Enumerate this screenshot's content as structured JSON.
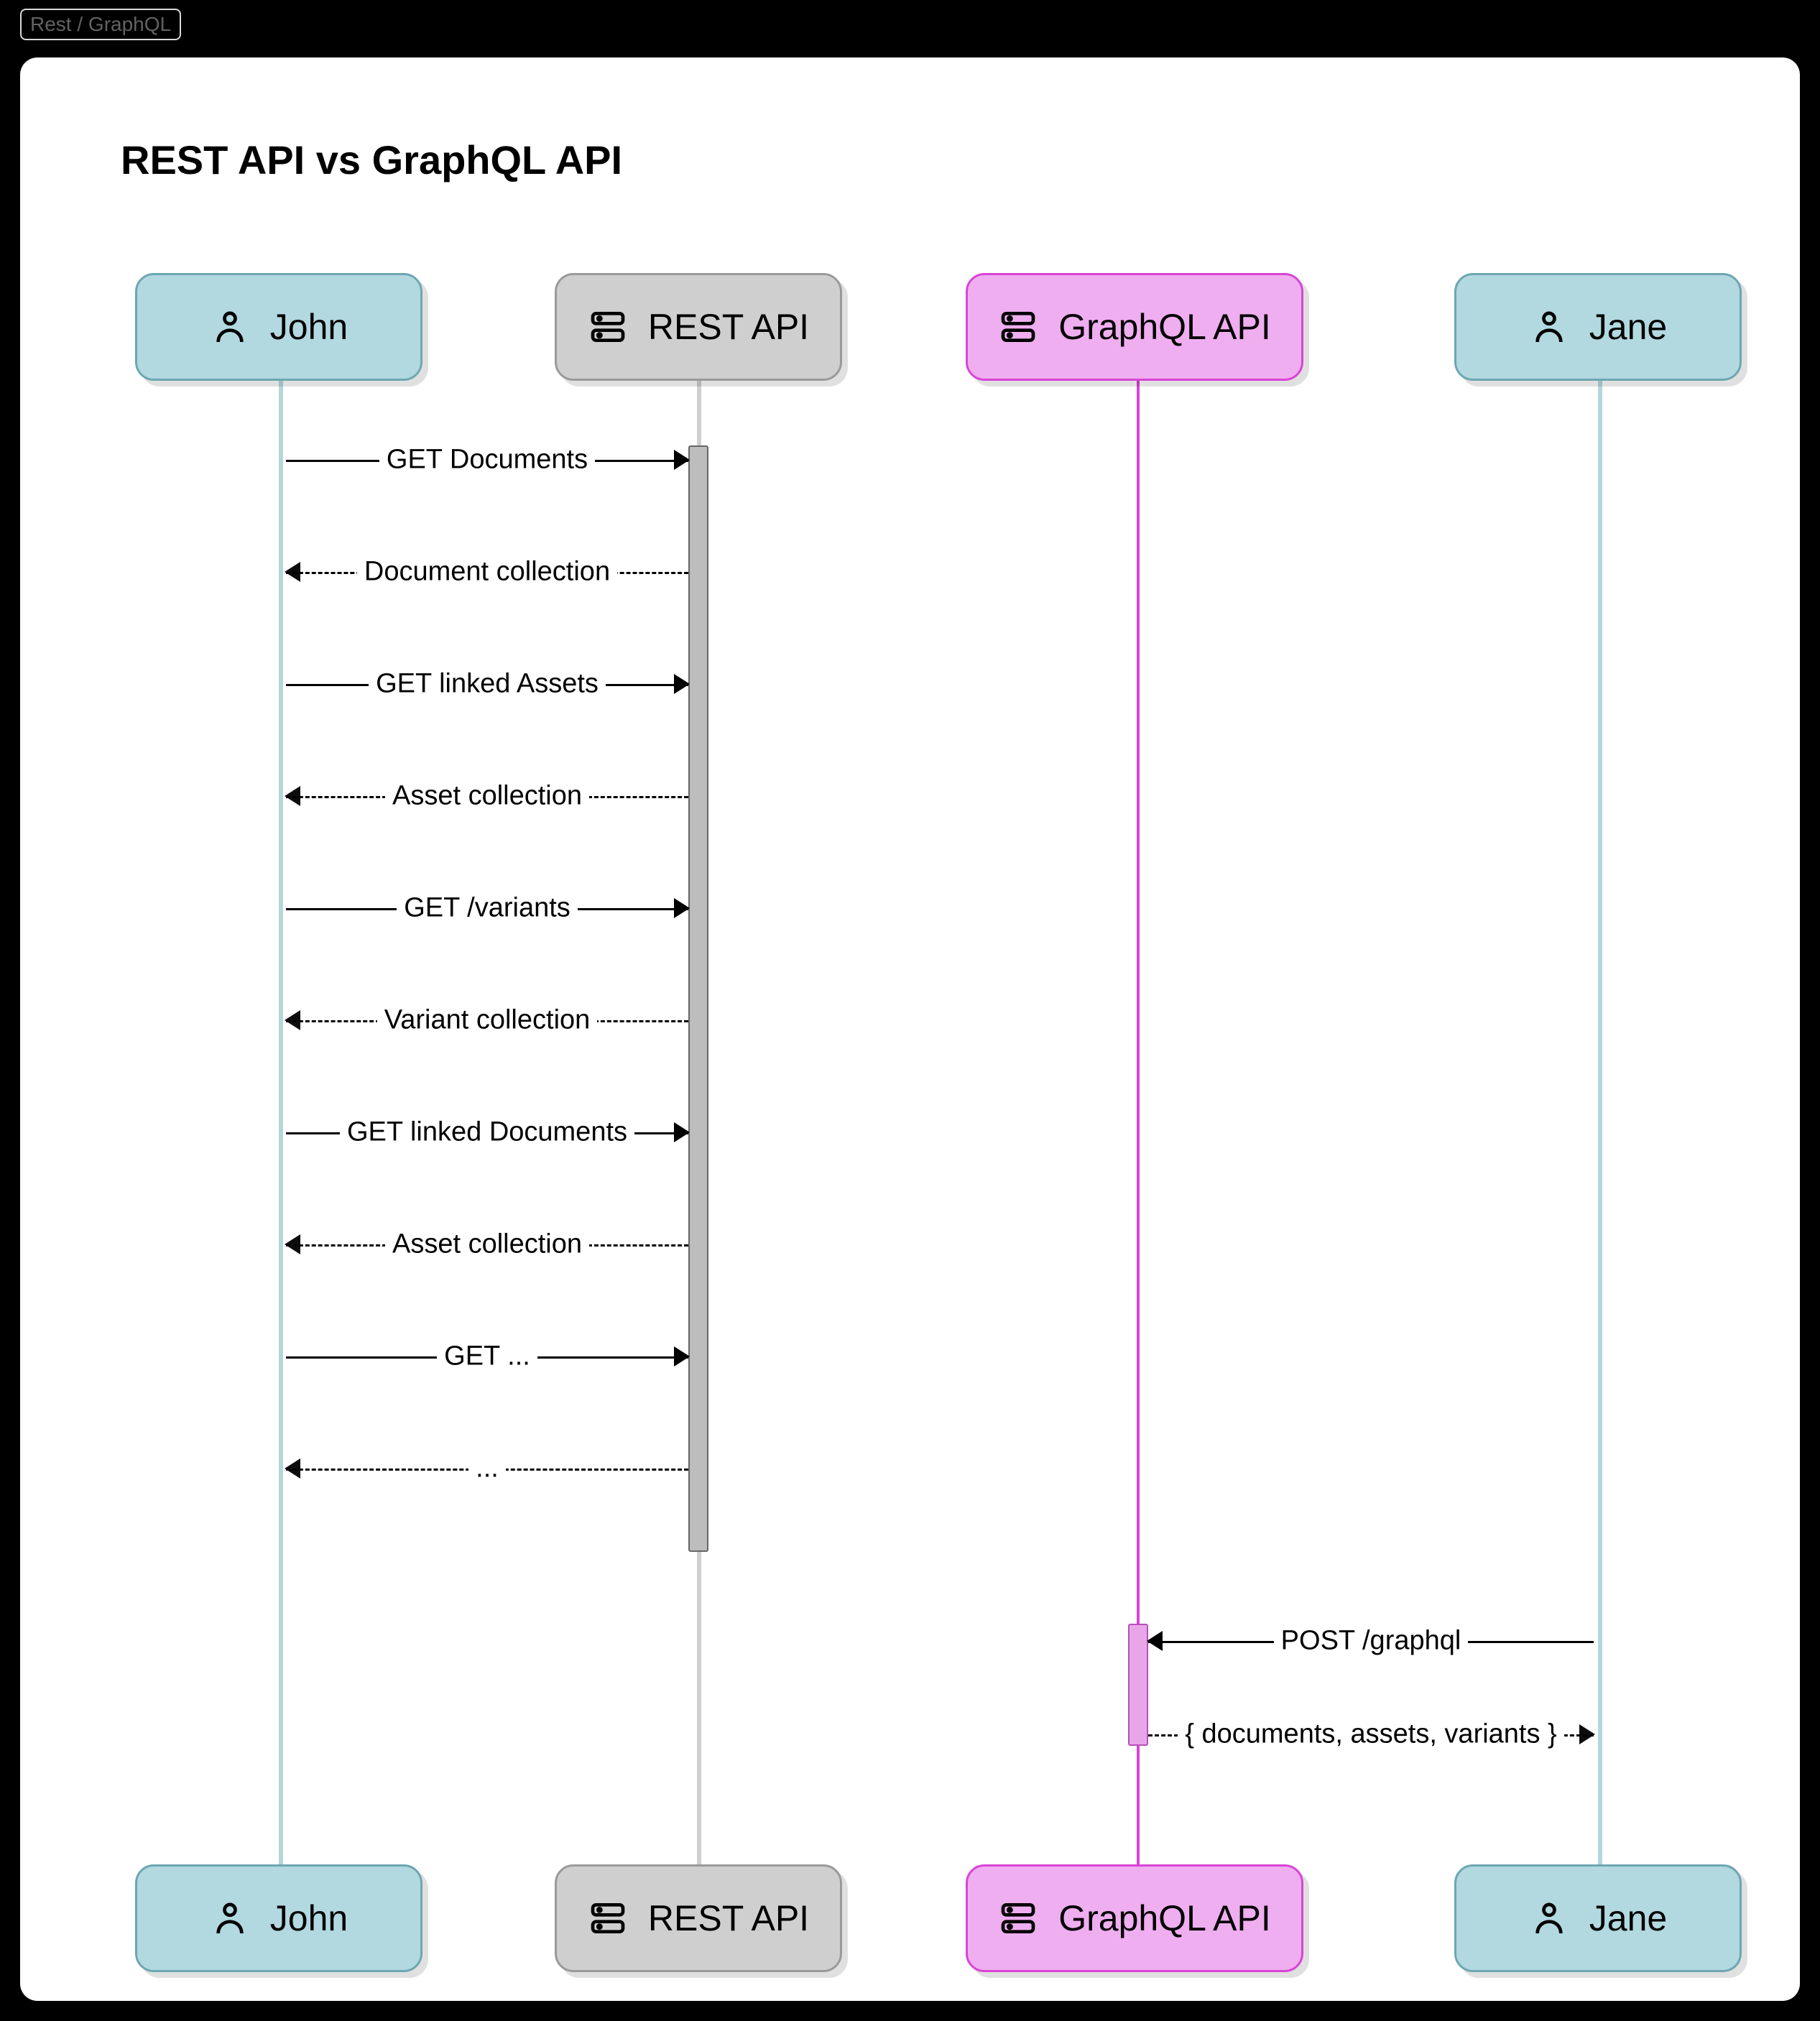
{
  "tab": {
    "label": "Rest / GraphQL"
  },
  "title": "REST API vs GraphQL API",
  "actors": {
    "john": "John",
    "rest": "REST API",
    "gql": "GraphQL API",
    "jane": "Jane"
  },
  "messages": {
    "rest_seq": [
      {
        "dir": "r",
        "style": "solid",
        "text": "GET Documents"
      },
      {
        "dir": "l",
        "style": "dashed",
        "text": "Document collection"
      },
      {
        "dir": "r",
        "style": "solid",
        "text": "GET linked Assets"
      },
      {
        "dir": "l",
        "style": "dashed",
        "text": "Asset collection"
      },
      {
        "dir": "r",
        "style": "solid",
        "text": "GET /variants"
      },
      {
        "dir": "l",
        "style": "dashed",
        "text": "Variant collection"
      },
      {
        "dir": "r",
        "style": "solid",
        "text": "GET linked Documents"
      },
      {
        "dir": "l",
        "style": "dashed",
        "text": "Asset collection"
      },
      {
        "dir": "r",
        "style": "solid",
        "text": "GET ..."
      },
      {
        "dir": "l",
        "style": "dashed",
        "text": "..."
      }
    ],
    "gql_seq": [
      {
        "dir": "l",
        "style": "solid",
        "text": "POST /graphql"
      },
      {
        "dir": "r",
        "style": "dashed",
        "text": "{ documents, assets, variants }"
      }
    ]
  },
  "icons": {
    "person": "person-icon",
    "server": "server-icon"
  },
  "colors": {
    "actor_person_bg": "#b2d8e0",
    "actor_person_border": "#6da7b1",
    "actor_rest_bg": "#cfcfcf",
    "actor_rest_border": "#9a9a9a",
    "actor_gql_bg": "#efaeef",
    "actor_gql_border": "#d944d6",
    "lifeline_person": "#b4d6dc",
    "lifeline_rest": "#cfcfcf",
    "lifeline_gql": "#d944d6"
  }
}
